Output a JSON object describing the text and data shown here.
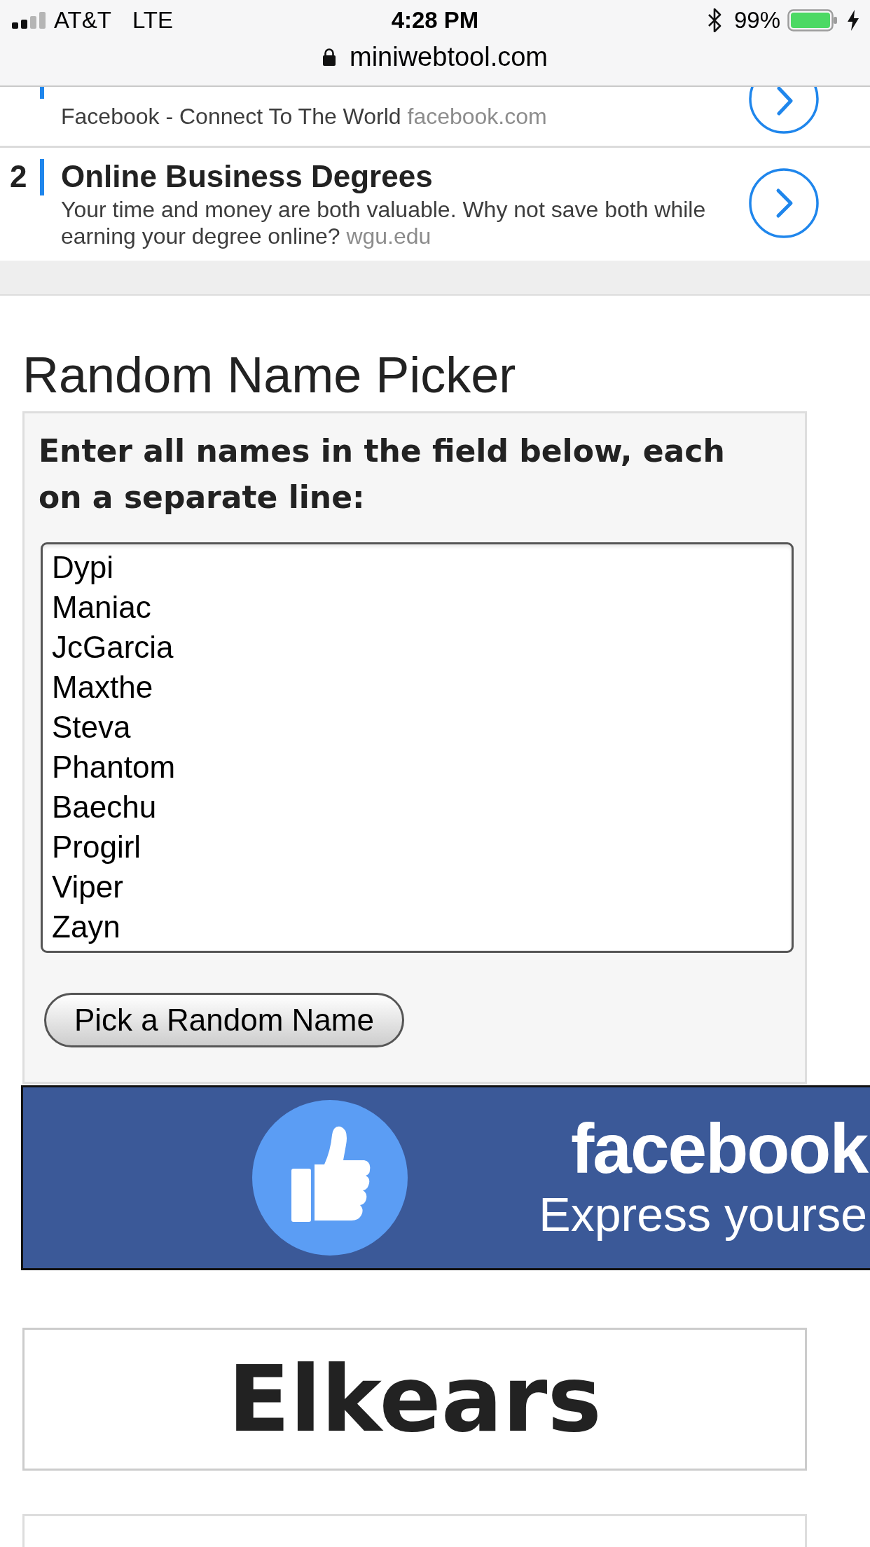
{
  "status_bar": {
    "carrier": "AT&T",
    "network": "LTE",
    "time": "4:28 PM",
    "battery": "99%"
  },
  "address_bar": {
    "url": "miniwebtool.com"
  },
  "ads": [
    {
      "kind": "partial",
      "description": "Facebook - Connect To The World",
      "domain": "facebook.com"
    },
    {
      "kind": "full",
      "number": "2",
      "title": "Online Business Degrees",
      "description": "Your time and money are both valuable. Why not save both while earning your degree online?",
      "domain": "wgu.edu"
    }
  ],
  "picker": {
    "title": "Random Name Picker",
    "instruction": "Enter all names in the field below, each on a separate line:",
    "names": [
      "Dypi",
      "Maniac",
      "JcGarcia",
      "Maxthe",
      "Steva",
      "Phantom",
      "Baechu",
      "Progirl",
      "Viper",
      "Zayn"
    ],
    "button": "Pick a Random Name"
  },
  "banner": {
    "brand": "facebook",
    "tagline": "Express yourse"
  },
  "result": {
    "name": "Elkears"
  }
}
